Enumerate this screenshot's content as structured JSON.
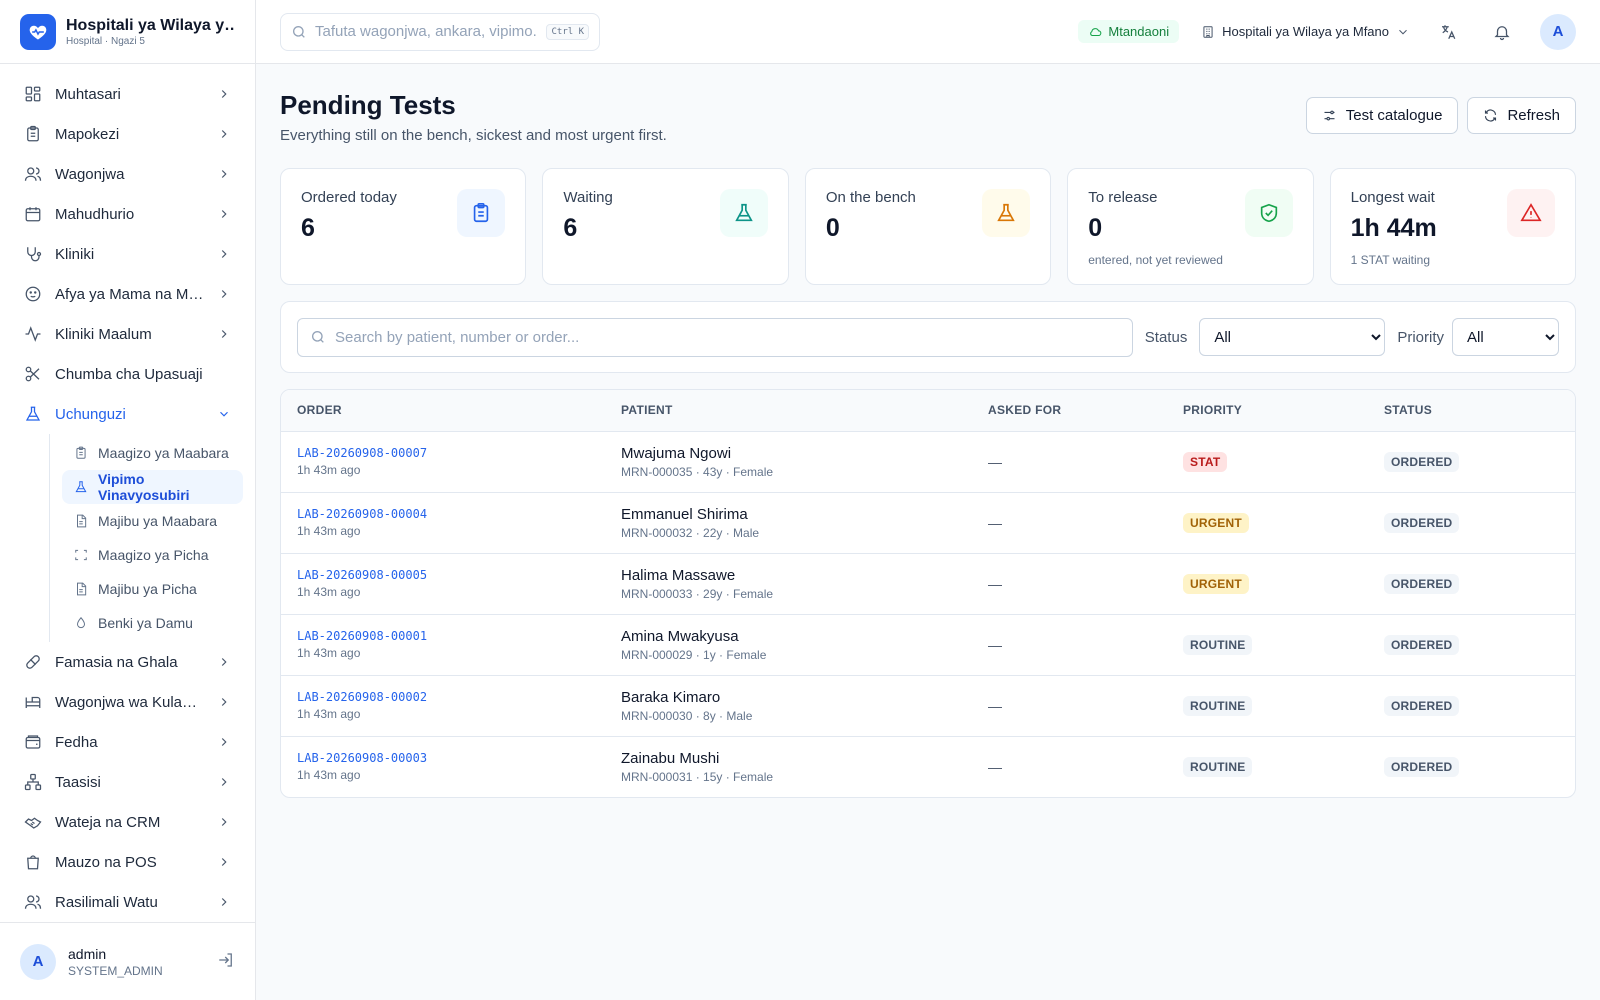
{
  "brand": {
    "name": "Hospitali ya Wilaya ya Mfano",
    "subtitle": "Hospital · Ngazi 5"
  },
  "sidebar": {
    "items": [
      {
        "label": "Muhtasari",
        "icon": "grid-icon",
        "has_chevron": true
      },
      {
        "label": "Mapokezi",
        "icon": "clipboard-icon",
        "has_chevron": true
      },
      {
        "label": "Wagonjwa",
        "icon": "users-icon",
        "has_chevron": true
      },
      {
        "label": "Mahudhurio",
        "icon": "calendar-icon",
        "has_chevron": true
      },
      {
        "label": "Kliniki",
        "icon": "stethoscope-icon",
        "has_chevron": true
      },
      {
        "label": "Afya ya Mama na Mtoto",
        "icon": "baby-icon",
        "has_chevron": true
      },
      {
        "label": "Kliniki Maalum",
        "icon": "activity-icon",
        "has_chevron": true
      },
      {
        "label": "Chumba cha Upasuaji",
        "icon": "scissors-icon",
        "has_chevron": false
      },
      {
        "label": "Uchunguzi",
        "icon": "flask-icon",
        "has_chevron": true,
        "expanded": true
      }
    ],
    "sub_items": [
      {
        "label": "Maagizo ya Maabara",
        "icon": "clipboard-icon"
      },
      {
        "label": "Vipimo Vinavyosubiri",
        "icon": "flask-icon",
        "active": true
      },
      {
        "label": "Majibu ya Maabara",
        "icon": "file-icon"
      },
      {
        "label": "Maagizo ya Picha",
        "icon": "scan-icon"
      },
      {
        "label": "Majibu ya Picha",
        "icon": "file-icon"
      },
      {
        "label": "Benki ya Damu",
        "icon": "droplet-icon"
      }
    ],
    "items_after": [
      {
        "label": "Famasia na Ghala",
        "icon": "pill-icon"
      },
      {
        "label": "Wagonjwa wa Kulazwa",
        "icon": "bed-icon"
      },
      {
        "label": "Fedha",
        "icon": "wallet-icon"
      },
      {
        "label": "Taasisi",
        "icon": "network-icon"
      },
      {
        "label": "Wateja na CRM",
        "icon": "handshake-icon"
      },
      {
        "label": "Mauzo na POS",
        "icon": "shopping-bag-icon"
      },
      {
        "label": "Rasilimali Watu",
        "icon": "users-icon"
      }
    ]
  },
  "user": {
    "initial": "A",
    "name": "admin",
    "role": "SYSTEM_ADMIN"
  },
  "topbar": {
    "search_placeholder": "Tafuta wagonjwa, ankara, vipimo...",
    "shortcut": "Ctrl K",
    "online_label": "Mtandaoni",
    "facility": "Hospitali ya Wilaya ya Mfano",
    "avatar_initial": "A"
  },
  "page": {
    "title": "Pending Tests",
    "subtitle": "Everything still on the bench, sickest and most urgent first.",
    "catalogue_button": "Test catalogue",
    "refresh_button": "Refresh"
  },
  "stats": [
    {
      "label": "Ordered today",
      "value": "6",
      "note": "",
      "icon": "clipboard-list-icon",
      "color": "#2563eb",
      "bg": "#eff6ff"
    },
    {
      "label": "Waiting",
      "value": "6",
      "note": "",
      "icon": "flask-icon",
      "color": "#0d9488",
      "bg": "#f0fdfa"
    },
    {
      "label": "On the bench",
      "value": "0",
      "note": "",
      "icon": "flask-icon",
      "color": "#d97706",
      "bg": "#fffbeb"
    },
    {
      "label": "To release",
      "value": "0",
      "note": "entered, not yet reviewed",
      "icon": "shield-check-icon",
      "color": "#16a34a",
      "bg": "#f0fdf4"
    },
    {
      "label": "Longest wait",
      "value": "1h 44m",
      "note": "1 STAT waiting",
      "icon": "alert-triangle-icon",
      "color": "#dc2626",
      "bg": "#fef2f2"
    }
  ],
  "filters": {
    "search_placeholder": "Search by patient, number or order...",
    "status_label": "Status",
    "status_value": "All",
    "priority_label": "Priority",
    "priority_value": "All"
  },
  "table": {
    "headers": [
      "ORDER",
      "PATIENT",
      "ASKED FOR",
      "PRIORITY",
      "STATUS"
    ],
    "rows": [
      {
        "order": "LAB-20260908-00007",
        "ago": "1h 43m ago",
        "patient": "Mwajuma Ngowi",
        "meta": "MRN-000035 · 43y · Female",
        "asked": "—",
        "priority": "STAT",
        "status": "ORDERED"
      },
      {
        "order": "LAB-20260908-00004",
        "ago": "1h 43m ago",
        "patient": "Emmanuel Shirima",
        "meta": "MRN-000032 · 22y · Male",
        "asked": "—",
        "priority": "URGENT",
        "status": "ORDERED"
      },
      {
        "order": "LAB-20260908-00005",
        "ago": "1h 43m ago",
        "patient": "Halima Massawe",
        "meta": "MRN-000033 · 29y · Female",
        "asked": "—",
        "priority": "URGENT",
        "status": "ORDERED"
      },
      {
        "order": "LAB-20260908-00001",
        "ago": "1h 43m ago",
        "patient": "Amina Mwakyusa",
        "meta": "MRN-000029 · 1y · Female",
        "asked": "—",
        "priority": "ROUTINE",
        "status": "ORDERED"
      },
      {
        "order": "LAB-20260908-00002",
        "ago": "1h 43m ago",
        "patient": "Baraka Kimaro",
        "meta": "MRN-000030 · 8y · Male",
        "asked": "—",
        "priority": "ROUTINE",
        "status": "ORDERED"
      },
      {
        "order": "LAB-20260908-00003",
        "ago": "1h 43m ago",
        "patient": "Zainabu Mushi",
        "meta": "MRN-000031 · 15y · Female",
        "asked": "—",
        "priority": "ROUTINE",
        "status": "ORDERED"
      }
    ]
  },
  "colors": {
    "accent": "#2563eb",
    "stat_bg": "#fee2e2",
    "stat_fg": "#b91c1c",
    "urgent_bg": "#fef3c7",
    "urgent_fg": "#a16207",
    "routine_bg": "#f1f5f9",
    "routine_fg": "#475569"
  }
}
